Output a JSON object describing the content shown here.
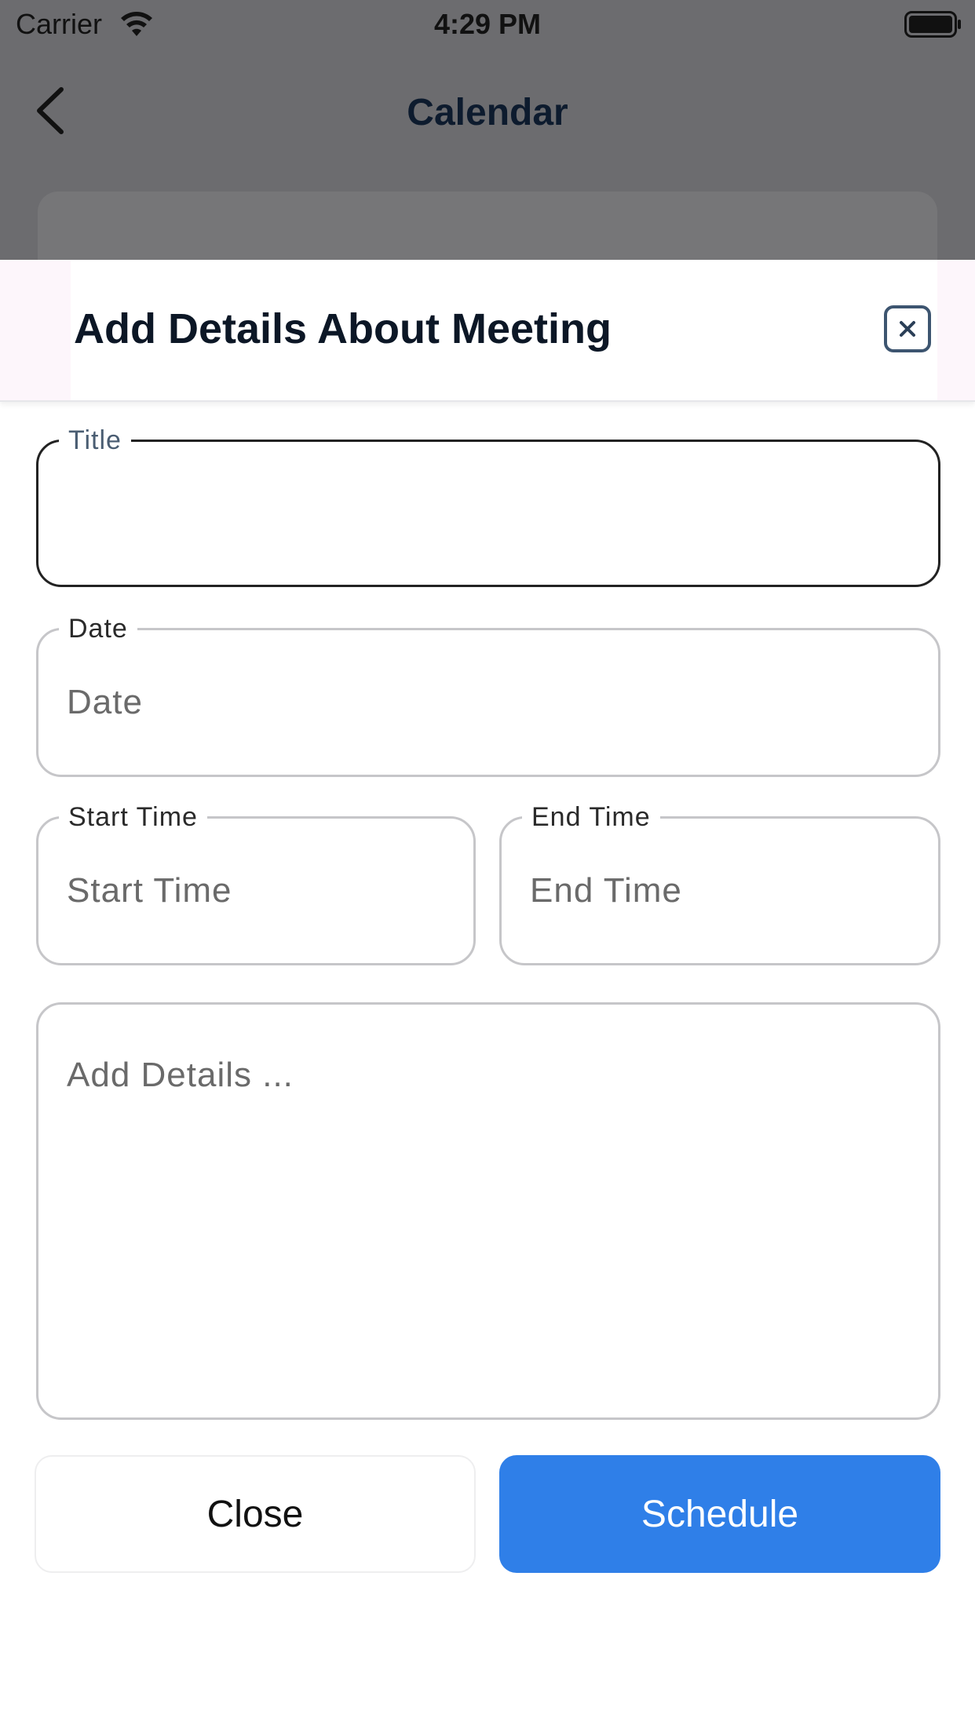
{
  "status_bar": {
    "carrier": "Carrier",
    "time": "4:29 PM"
  },
  "nav": {
    "title": "Calendar"
  },
  "modal": {
    "title": "Add Details About Meeting",
    "fields": {
      "title": {
        "label": "Title",
        "value": ""
      },
      "date": {
        "label": "Date",
        "placeholder": "Date"
      },
      "start_time": {
        "label": "Start Time",
        "placeholder": "Start Time"
      },
      "end_time": {
        "label": "End Time",
        "placeholder": "End Time"
      },
      "details": {
        "placeholder": "Add Details ..."
      }
    },
    "buttons": {
      "close": "Close",
      "schedule": "Schedule"
    }
  },
  "colors": {
    "overlay": "#6c6c6f",
    "primary": "#2f7fe8",
    "title_text": "#0c1726",
    "border": "#c6c6c9",
    "focused_border": "#222222"
  }
}
